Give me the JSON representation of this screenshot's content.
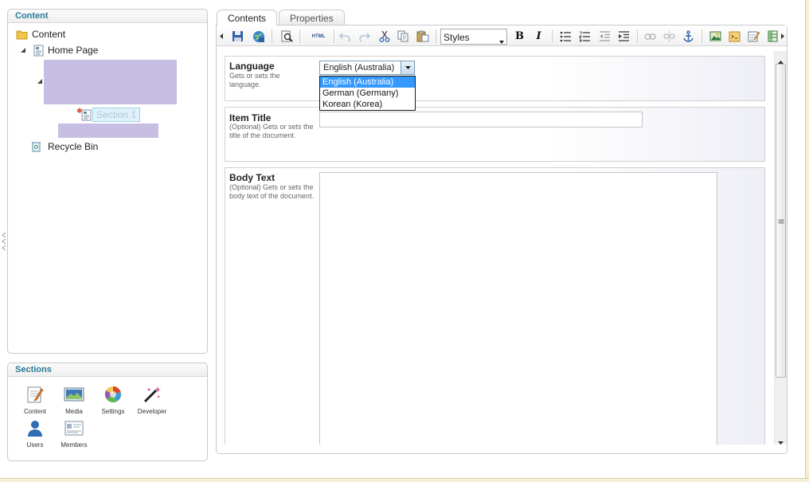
{
  "content_panel": {
    "title": "Content",
    "tree": {
      "root_label": "Content",
      "home_label": "Home Page",
      "section_label": "Section 1",
      "recycle_label": "Recycle Bin"
    }
  },
  "sections_panel": {
    "title": "Sections",
    "items": [
      {
        "label": "Content",
        "icon": "content-section-icon"
      },
      {
        "label": "Media",
        "icon": "media-section-icon"
      },
      {
        "label": "Settings",
        "icon": "settings-section-icon"
      },
      {
        "label": "Developer",
        "icon": "developer-section-icon"
      },
      {
        "label": "Users",
        "icon": "users-section-icon"
      },
      {
        "label": "Members",
        "icon": "members-section-icon"
      }
    ]
  },
  "tabs": [
    {
      "label": "Contents",
      "active": true
    },
    {
      "label": "Properties",
      "active": false
    }
  ],
  "toolbar": {
    "html_label": "HTML",
    "styles_value": "Styles",
    "bold_label": "B",
    "italic_label": "I"
  },
  "form": {
    "language": {
      "label": "Language",
      "description": "Gets or sets the language.",
      "value": "English (Australia)",
      "options": [
        "English (Australia)",
        "German (Germany)",
        "Korean (Korea)"
      ],
      "selected_index": 0
    },
    "item_title": {
      "label": "Item Title",
      "description": "(Optional) Gets or sets the title of the document.",
      "value": ""
    },
    "body_text": {
      "label": "Body Text",
      "description": "(Optional) Gets or sets the body text of the document.",
      "value": ""
    }
  },
  "colors": {
    "panel_title": "#2a7a96",
    "selection_blue": "#3399ff",
    "redaction": "#c7bfe3",
    "frame_border": "#f4efd5"
  }
}
